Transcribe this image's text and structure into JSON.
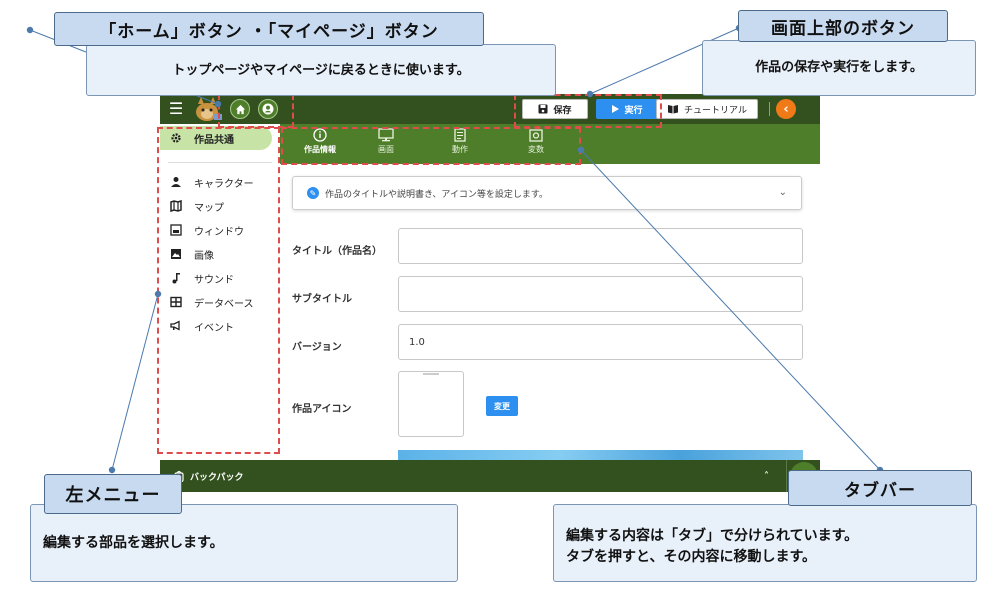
{
  "app": {
    "topbar": {
      "save_label": "保存",
      "run_label": "実行",
      "tutorial_label": "チュートリアル"
    },
    "tabs": [
      {
        "label": "作品情報",
        "icon": "info-icon",
        "active": true
      },
      {
        "label": "画面",
        "icon": "monitor-icon",
        "active": false
      },
      {
        "label": "動作",
        "icon": "document-icon",
        "active": false
      },
      {
        "label": "変数",
        "icon": "variable-icon",
        "active": false
      }
    ],
    "sidebar": {
      "items": [
        {
          "label": "作品共通",
          "icon": "gear-icon",
          "active": true
        },
        {
          "label": "キャラクター",
          "icon": "person-icon"
        },
        {
          "label": "マップ",
          "icon": "map-icon"
        },
        {
          "label": "ウィンドウ",
          "icon": "window-icon"
        },
        {
          "label": "画像",
          "icon": "image-icon"
        },
        {
          "label": "サウンド",
          "icon": "music-note-icon"
        },
        {
          "label": "データベース",
          "icon": "table-icon"
        },
        {
          "label": "イベント",
          "icon": "megaphone-icon"
        }
      ]
    },
    "main": {
      "info_text": "作品のタイトルや説明書き、アイコン等を設定します。",
      "fields": {
        "title_label": "タイトル（作品名）",
        "title_value": "",
        "subtitle_label": "サブタイトル",
        "subtitle_value": "",
        "version_label": "バージョン",
        "version_value": "1.0",
        "icon_label": "作品アイコン",
        "change_button": "変更"
      }
    },
    "backpack_label": "バックパック",
    "colors": {
      "topbar": "#33511f",
      "tabbar": "#4f7e2b",
      "sidebar_active": "#c7e3a6",
      "primary_button": "#2d8ff0",
      "collapse_button": "#f07a18"
    }
  },
  "callouts": {
    "home_mypage": {
      "title": "「ホーム」ボタン ・「マイページ」ボタン",
      "description": "トップページやマイページに戻るときに使います。"
    },
    "top_buttons": {
      "title": "画面上部のボタン",
      "description": "作品の保存や実行をします。"
    },
    "left_menu": {
      "title": "左メニュー",
      "description": "編集する部品を選択します。"
    },
    "tabbar": {
      "title": "タブバー",
      "description_line1": "編集する内容は「タブ」で分けられています。",
      "description_line2": "タブを押すと、その内容に移動します。"
    },
    "colors": {
      "dashed_border": "#e04c4c",
      "title_bg": "#c8daf0",
      "desc_bg": "#e8f0fa",
      "connector": "#4c7aad"
    }
  }
}
